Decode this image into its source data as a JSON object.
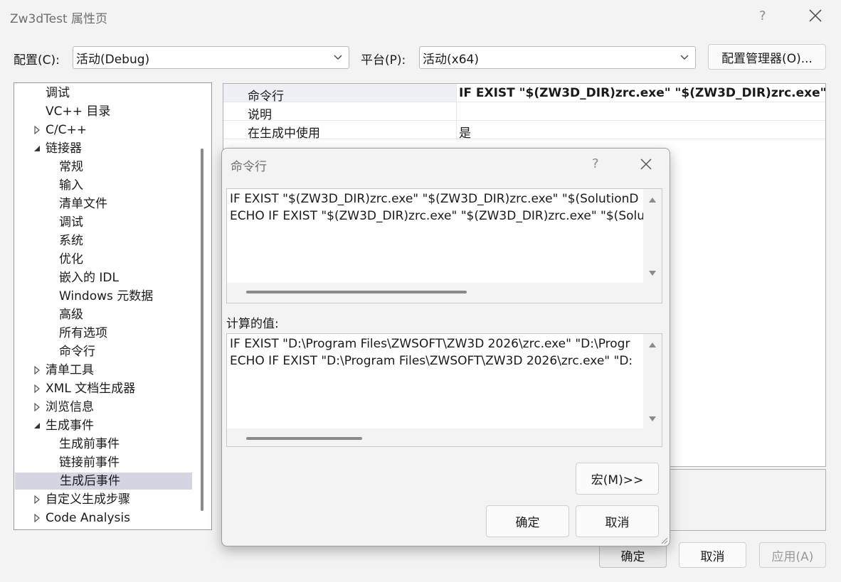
{
  "window": {
    "title": "Zw3dTest 属性页",
    "help_glyph": "?",
    "config_label": "配置(C):",
    "config_value": "活动(Debug)",
    "platform_label": "平台(P):",
    "platform_value": "活动(x64)",
    "config_manager_label": "配置管理器(O)...",
    "ok_label": "确定",
    "cancel_label": "取消",
    "apply_label": "应用(A)"
  },
  "tree": {
    "items": [
      {
        "label": "调试",
        "level": 1,
        "arrow": "none"
      },
      {
        "label": "VC++ 目录",
        "level": 1,
        "arrow": "none"
      },
      {
        "label": "C/C++",
        "level": 1,
        "arrow": "collapsed"
      },
      {
        "label": "链接器",
        "level": 1,
        "arrow": "expanded"
      },
      {
        "label": "常规",
        "level": 2,
        "arrow": "none"
      },
      {
        "label": "输入",
        "level": 2,
        "arrow": "none"
      },
      {
        "label": "清单文件",
        "level": 2,
        "arrow": "none"
      },
      {
        "label": "调试",
        "level": 2,
        "arrow": "none"
      },
      {
        "label": "系统",
        "level": 2,
        "arrow": "none"
      },
      {
        "label": "优化",
        "level": 2,
        "arrow": "none"
      },
      {
        "label": "嵌入的 IDL",
        "level": 2,
        "arrow": "none"
      },
      {
        "label": "Windows 元数据",
        "level": 2,
        "arrow": "none"
      },
      {
        "label": "高级",
        "level": 2,
        "arrow": "none"
      },
      {
        "label": "所有选项",
        "level": 2,
        "arrow": "none"
      },
      {
        "label": "命令行",
        "level": 2,
        "arrow": "none"
      },
      {
        "label": "清单工具",
        "level": 1,
        "arrow": "collapsed"
      },
      {
        "label": "XML 文档生成器",
        "level": 1,
        "arrow": "collapsed"
      },
      {
        "label": "浏览信息",
        "level": 1,
        "arrow": "collapsed"
      },
      {
        "label": "生成事件",
        "level": 1,
        "arrow": "expanded"
      },
      {
        "label": "生成前事件",
        "level": 2,
        "arrow": "none"
      },
      {
        "label": "链接前事件",
        "level": 2,
        "arrow": "none"
      },
      {
        "label": "生成后事件",
        "level": 2,
        "arrow": "none",
        "selected": true
      },
      {
        "label": "自定义生成步骤",
        "level": 1,
        "arrow": "collapsed"
      },
      {
        "label": "Code Analysis",
        "level": 1,
        "arrow": "collapsed"
      }
    ]
  },
  "grid": {
    "rows": [
      {
        "key": "命令行",
        "value": "IF EXIST \"$(ZW3D_DIR)zrc.exe\" \"$(ZW3D_DIR)zrc.exe\" \"$(",
        "bold": true
      },
      {
        "key": "说明",
        "value": ""
      },
      {
        "key": "在生成中使用",
        "value": "是"
      }
    ]
  },
  "dialog": {
    "title": "命令行",
    "help_glyph": "?",
    "command_lines": [
      "IF EXIST \"$(ZW3D_DIR)zrc.exe\" \"$(ZW3D_DIR)zrc.exe\" \"$(SolutionD",
      "ECHO IF EXIST \"$(ZW3D_DIR)zrc.exe\" \"$(ZW3D_DIR)zrc.exe\" \"$(Solu"
    ],
    "evaluated_label": "计算的值:",
    "evaluated_lines": [
      "IF EXIST \"D:\\Program Files\\ZWSOFT\\ZW3D 2026\\zrc.exe\" \"D:\\Progr",
      "ECHO IF EXIST \"D:\\Program Files\\ZWSOFT\\ZW3D 2026\\zrc.exe\" \"D:"
    ],
    "macros_label": "宏(M)>>",
    "ok_label": "确定",
    "cancel_label": "取消"
  },
  "colors": {
    "selection": "#d4d4e3",
    "window_bg": "#f3f3f3"
  }
}
